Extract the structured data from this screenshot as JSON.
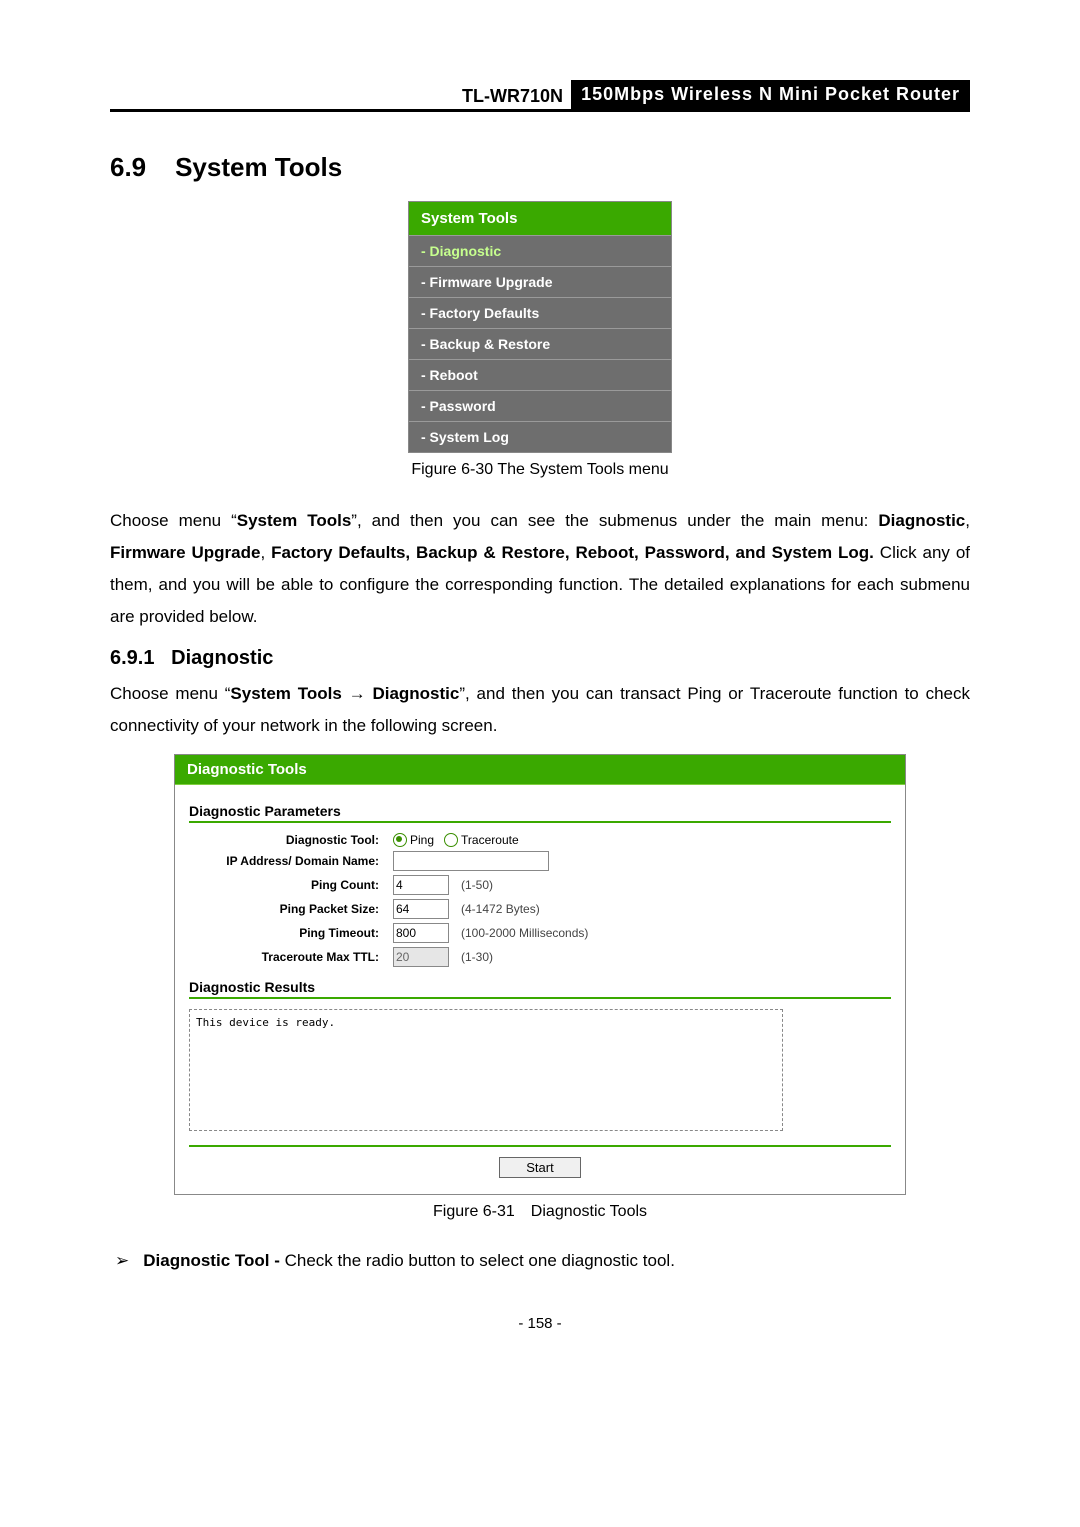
{
  "header": {
    "model": "TL-WR710N",
    "product": "150Mbps Wireless N Mini Pocket Router"
  },
  "section": {
    "number": "6.9",
    "title": "System Tools"
  },
  "menu": {
    "title": "System Tools",
    "items": [
      {
        "label": "- Diagnostic",
        "active": true
      },
      {
        "label": "- Firmware Upgrade",
        "active": false
      },
      {
        "label": "- Factory Defaults",
        "active": false
      },
      {
        "label": "- Backup & Restore",
        "active": false
      },
      {
        "label": "- Reboot",
        "active": false
      },
      {
        "label": "- Password",
        "active": false
      },
      {
        "label": "- System Log",
        "active": false
      }
    ],
    "caption": "Figure 6-30 The System Tools menu"
  },
  "para1": {
    "pre": "Choose menu “",
    "bold1": "System Tools",
    "mid": "”, and then you can see the submenus under the main menu: ",
    "bold2": "Diagnostic",
    "sep1": ", ",
    "bold3": "Firmware Upgrade",
    "sep2": ", ",
    "bold4": "Factory Defaults, Backup & Restore, Reboot, Password, and System Log.",
    "tail": " Click any of them, and you will be able to configure the corresponding function. The detailed explanations for each submenu are provided below."
  },
  "subsection": {
    "number": "6.9.1",
    "title": "Diagnostic"
  },
  "para2": {
    "pre": "Choose menu “",
    "bold1": "System Tools",
    "arrow": " → ",
    "bold2": "Diagnostic",
    "tail": "”, and then you can transact Ping or Traceroute function to check connectivity of your network in the following screen."
  },
  "diag": {
    "title": "Diagnostic Tools",
    "params_heading": "Diagnostic Parameters",
    "labels": {
      "tool": "Diagnostic Tool:",
      "ip": "IP Address/ Domain Name:",
      "count": "Ping Count:",
      "size": "Ping Packet Size:",
      "timeout": "Ping Timeout:",
      "ttl": "Traceroute Max TTL:"
    },
    "radios": {
      "ping": "Ping",
      "traceroute": "Traceroute"
    },
    "values": {
      "ip": "",
      "count": "4",
      "size": "64",
      "timeout": "800",
      "ttl": "20"
    },
    "hints": {
      "count": "(1-50)",
      "size": "(4-1472 Bytes)",
      "timeout": "(100-2000 Milliseconds)",
      "ttl": "(1-30)"
    },
    "results_heading": "Diagnostic Results",
    "results_text": "This device is ready.",
    "start": "Start",
    "caption": "Figure 6-31 Diagnostic Tools"
  },
  "bullet": {
    "marker": "➢",
    "bold": "Diagnostic Tool - ",
    "text": "Check the radio button to select one diagnostic tool."
  },
  "page_number": "- 158 -"
}
